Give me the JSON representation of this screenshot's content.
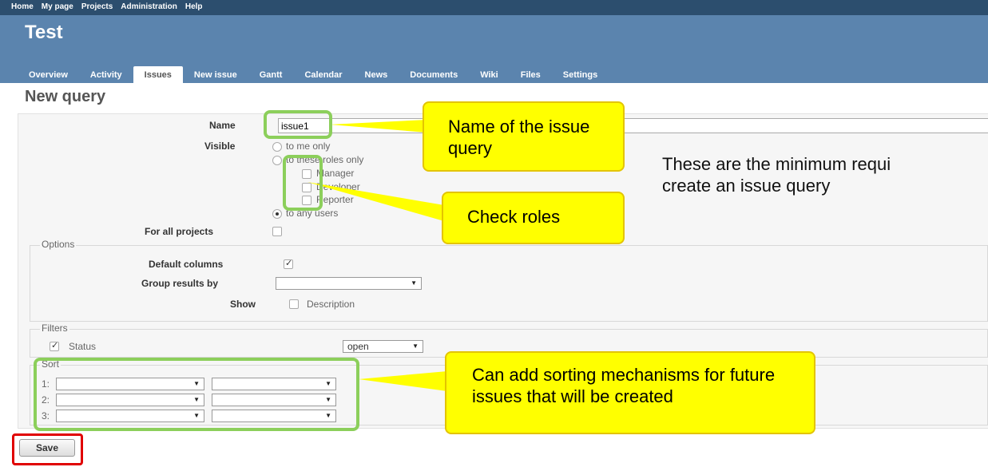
{
  "top_menu": [
    "Home",
    "My page",
    "Projects",
    "Administration",
    "Help"
  ],
  "project_title": "Test",
  "tabs": [
    {
      "label": "Overview"
    },
    {
      "label": "Activity"
    },
    {
      "label": "Issues"
    },
    {
      "label": "New issue"
    },
    {
      "label": "Gantt"
    },
    {
      "label": "Calendar"
    },
    {
      "label": "News"
    },
    {
      "label": "Documents"
    },
    {
      "label": "Wiki"
    },
    {
      "label": "Files"
    },
    {
      "label": "Settings"
    }
  ],
  "selected_tab": "Issues",
  "page_title": "New query",
  "form": {
    "name_label": "Name",
    "name_value": "issue1",
    "visible_label": "Visible",
    "visible_options": [
      "to me only",
      "to these roles only",
      "to any users"
    ],
    "roles": [
      "Manager",
      "Developer",
      "Reporter"
    ],
    "for_all_projects_label": "For all projects",
    "options_legend": "Options",
    "default_columns_label": "Default columns",
    "group_results_label": "Group results by",
    "show_label": "Show",
    "description_label": "Description",
    "filters_legend": "Filters",
    "status_label": "Status",
    "status_value": "open",
    "sort_legend": "Sort",
    "sort_rows": [
      "1:",
      "2:",
      "3:"
    ],
    "save_label": "Save"
  },
  "annotations": {
    "name_callout": "Name of the issue query",
    "roles_callout": "Check roles",
    "sort_callout": "Can add sorting mechanisms for future issues that will be created",
    "note_line1": "These are the minimum requi",
    "note_line2": "create an issue query"
  }
}
